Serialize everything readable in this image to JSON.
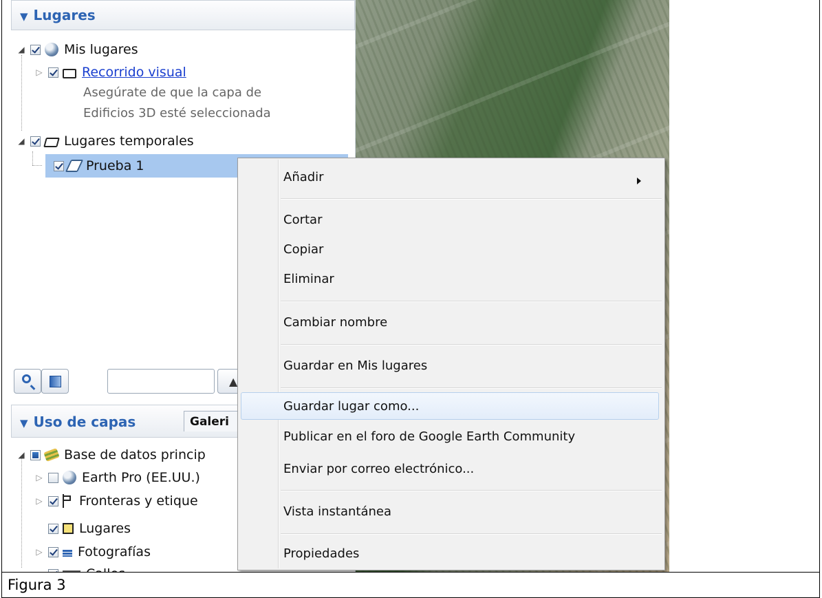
{
  "places_panel": {
    "title": "Lugares",
    "items": [
      {
        "label": "Mis lugares"
      },
      {
        "label": "Recorrido visual",
        "note_line1": "Asegúrate de que la capa de",
        "note_line2": "Edificios 3D esté seleccionada"
      },
      {
        "label": "Lugares temporales"
      },
      {
        "label": "Prueba 1"
      }
    ]
  },
  "layers_panel": {
    "title": "Uso de capas",
    "gallery_tab": "Galeri",
    "items": [
      {
        "label": "Base de datos princip"
      },
      {
        "label": "Earth Pro (EE.UU.)"
      },
      {
        "label": "Fronteras y etique"
      },
      {
        "label": "Lugares"
      },
      {
        "label": "Fotografías"
      },
      {
        "label": "Calles"
      }
    ]
  },
  "context_menu": {
    "items": [
      {
        "label": "Añadir"
      },
      {
        "label": "Cortar"
      },
      {
        "label": "Copiar"
      },
      {
        "label": "Eliminar"
      },
      {
        "label": "Cambiar nombre"
      },
      {
        "label": "Guardar en Mis lugares"
      },
      {
        "label": "Guardar lugar como..."
      },
      {
        "label": "Publicar en el foro de Google Earth Community"
      },
      {
        "label": "Enviar por correo electrónico..."
      },
      {
        "label": "Vista instantánea"
      },
      {
        "label": "Propiedades"
      }
    ]
  },
  "caption": "Figura 3",
  "colors": {
    "accent": "#2d64b3",
    "selection": "#a7c8ef",
    "menu_bg": "#f1f1f1"
  }
}
